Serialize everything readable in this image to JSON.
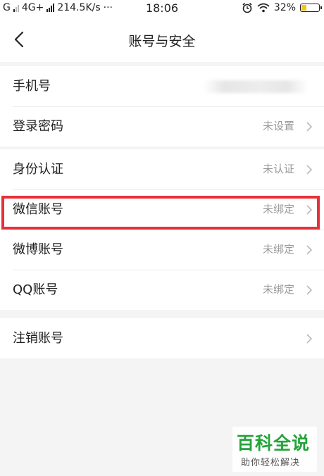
{
  "status_bar": {
    "network": "G",
    "network2": "4G+",
    "speed": "214.5K/s",
    "more": "···",
    "time": "18:06",
    "battery": "32%",
    "battery_level": 0.32
  },
  "header": {
    "title": "账号与安全"
  },
  "groups": [
    {
      "rows": [
        {
          "label": "手机号",
          "value": ""
        },
        {
          "label": "登录密码",
          "value": "未设置"
        }
      ]
    },
    {
      "rows": [
        {
          "label": "身份认证",
          "value": "未认证"
        },
        {
          "label": "微信账号",
          "value": "未绑定"
        },
        {
          "label": "微博账号",
          "value": "未绑定"
        },
        {
          "label": "QQ账号",
          "value": "未绑定"
        }
      ]
    },
    {
      "rows": [
        {
          "label": "注销账号",
          "value": ""
        }
      ]
    }
  ],
  "watermark": {
    "title": "百科全说",
    "subtitle": "助你轻松解决"
  },
  "colors": {
    "highlight": "#e8303a",
    "watermark_green": "#24a33a",
    "battery_fill": "#f5c518"
  }
}
